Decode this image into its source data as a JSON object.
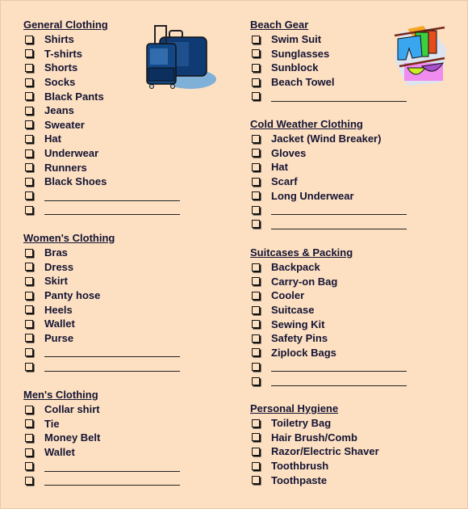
{
  "left_column": [
    {
      "title": "General Clothing",
      "items": [
        "Shirts",
        "T-shirts",
        "Shorts",
        "Socks",
        "Black Pants",
        "Jeans",
        "Sweater",
        "Hat",
        "Underwear",
        "Runners",
        "Black Shoes"
      ],
      "blank_lines": 2
    },
    {
      "title": "Women's Clothing",
      "items": [
        "Bras",
        "Dress",
        "Skirt",
        "Panty hose",
        "Heels",
        "Wallet",
        "Purse"
      ],
      "blank_lines": 2
    },
    {
      "title": "Men's Clothing",
      "items": [
        "Collar shirt",
        "Tie",
        "Money Belt",
        "Wallet"
      ],
      "blank_lines": 2
    }
  ],
  "right_column": [
    {
      "title": "Beach Gear",
      "items": [
        "Swim Suit",
        "Sunglasses",
        "Sunblock",
        "Beach Towel"
      ],
      "blank_lines": 1
    },
    {
      "title": "Cold Weather Clothing",
      "items": [
        "Jacket (Wind Breaker)",
        "Gloves",
        "Hat",
        "Scarf",
        "Long Underwear"
      ],
      "blank_lines": 2
    },
    {
      "title": "Suitcases & Packing",
      "items": [
        "Backpack",
        "Carry-on Bag",
        "Cooler",
        "Suitcase",
        "Sewing Kit",
        "Safety Pins",
        "Ziplock Bags"
      ],
      "blank_lines": 2
    },
    {
      "title": "Personal Hygiene",
      "items": [
        "Toiletry Bag",
        "Hair Brush/Comb",
        "Razor/Electric Shaver",
        "Toothbrush",
        "Toothpaste"
      ],
      "blank_lines": 0
    }
  ],
  "images": {
    "luggage": "luggage-clipart",
    "clothesline": "clothesline-clipart"
  },
  "colors": {
    "background": "#fde0c2",
    "text": "#141433"
  }
}
